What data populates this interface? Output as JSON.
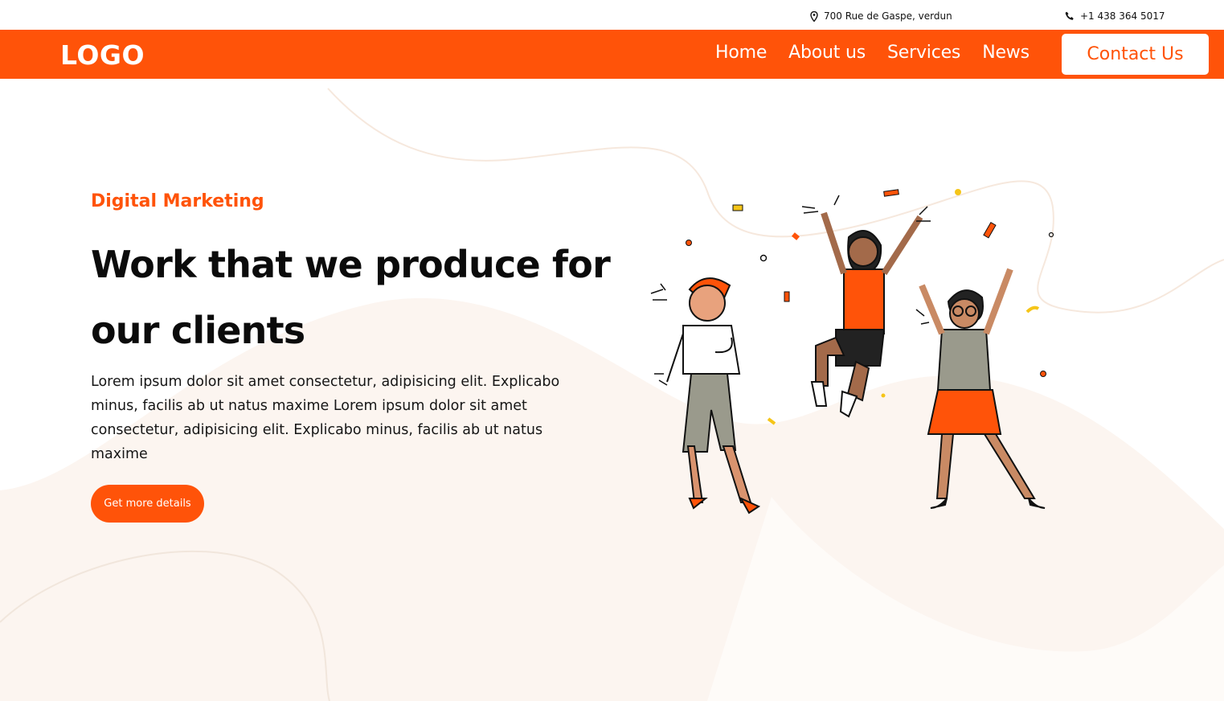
{
  "topbar": {
    "address": "700 Rue de Gaspe, verdun",
    "phone": "+1 438 364 5017",
    "address_icon": "map-pin-icon",
    "phone_icon": "phone-icon"
  },
  "nav": {
    "logo": "LOGO",
    "items": [
      {
        "label": "Home"
      },
      {
        "label": "About us"
      },
      {
        "label": "Services"
      },
      {
        "label": "News"
      }
    ],
    "contact_label": "Contact Us"
  },
  "hero": {
    "eyebrow": "Digital Marketing",
    "headline_line1": "Work that we produce for",
    "headline_line2": "our clients",
    "body": "Lorem ipsum dolor sit amet consectetur, adipisicing elit. Explicabo minus, facilis ab ut natus maxime Lorem ipsum dolor sit amet consectetur, adipisicing elit. Explicabo minus, facilis ab ut natus maxime",
    "cta_label": "Get more details"
  },
  "colors": {
    "brand": "#ff5309",
    "background_blob": "#fcf5f0",
    "text": "#111111"
  }
}
